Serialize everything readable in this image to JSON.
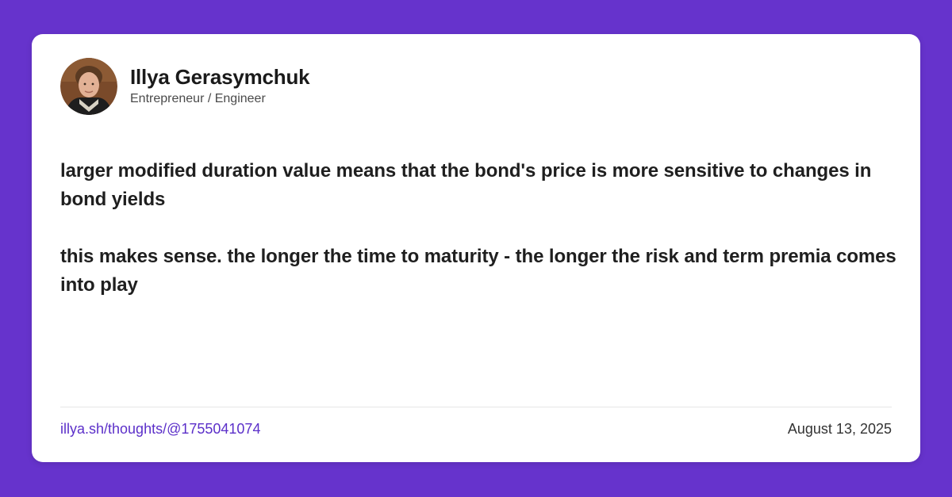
{
  "author": {
    "name": "Illya Gerasymchuk",
    "role": "Entrepreneur / Engineer"
  },
  "post": {
    "paragraphs": [
      "larger modified duration value means that the bond's price is more sensitive to changes in bond yields",
      "this makes sense. the longer the time to maturity - the longer the risk and term premia comes into play"
    ]
  },
  "footer": {
    "link_text": "illya.sh/thoughts/@1755041074",
    "date": "August 13, 2025"
  },
  "colors": {
    "background": "#6633cc",
    "card": "#ffffff",
    "link": "#5b2fc9"
  }
}
